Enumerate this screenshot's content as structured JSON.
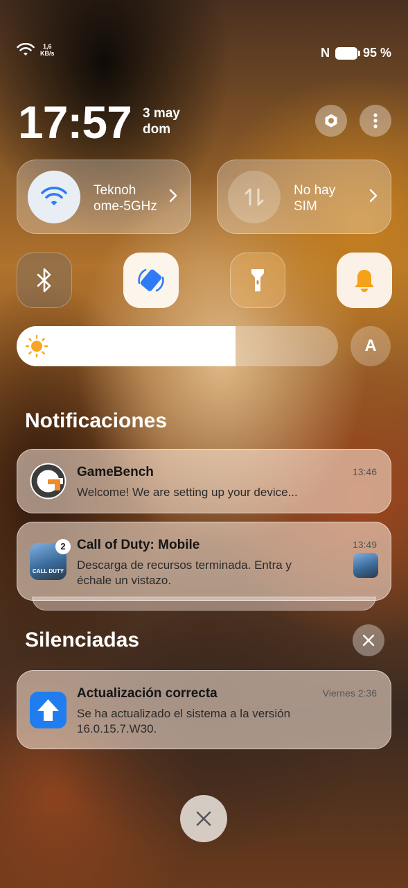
{
  "status_bar": {
    "speed_value": "1,6",
    "speed_unit": "KB/s",
    "nfc": "N",
    "battery": "95 %"
  },
  "header": {
    "time": "17:57",
    "date_day": "3 may",
    "date_weekday": "dom"
  },
  "quick_settings": {
    "wifi": {
      "line1": "Teknoh",
      "line2": "ome-5GHz",
      "active": true
    },
    "mobile": {
      "line1": "No hay",
      "line2": "SIM",
      "active": false
    },
    "toggles": [
      {
        "name": "bluetooth",
        "active": false
      },
      {
        "name": "auto-rotate",
        "active": true
      },
      {
        "name": "flashlight",
        "active": false
      },
      {
        "name": "sound",
        "active": true
      }
    ],
    "brightness_level": 0.68,
    "auto_brightness_label": "A"
  },
  "notifications": {
    "title": "Notificaciones",
    "items": [
      {
        "app": "GameBench",
        "body": "Welcome! We are setting up your device...",
        "time": "13:46"
      },
      {
        "app": "Call of Duty: Mobile",
        "body_line1": "Descarga de recursos terminada. Entra y",
        "body_line2": "échale un vistazo.",
        "time": "13:49",
        "badge": "2",
        "icon_text_1": "CALL",
        "icon_text_2": "DUTY"
      }
    ]
  },
  "silenced": {
    "title": "Silenciadas",
    "items": [
      {
        "app": "Actualización correcta",
        "body_line1": "Se ha actualizado el sistema a la versión",
        "body_line2": "16.0.15.7.W30.",
        "time": "Viernes 2:36"
      }
    ]
  },
  "colors": {
    "accent_blue": "#2f7bf5",
    "bell_orange": "#f5a11a",
    "sun_orange": "#f6a623"
  }
}
